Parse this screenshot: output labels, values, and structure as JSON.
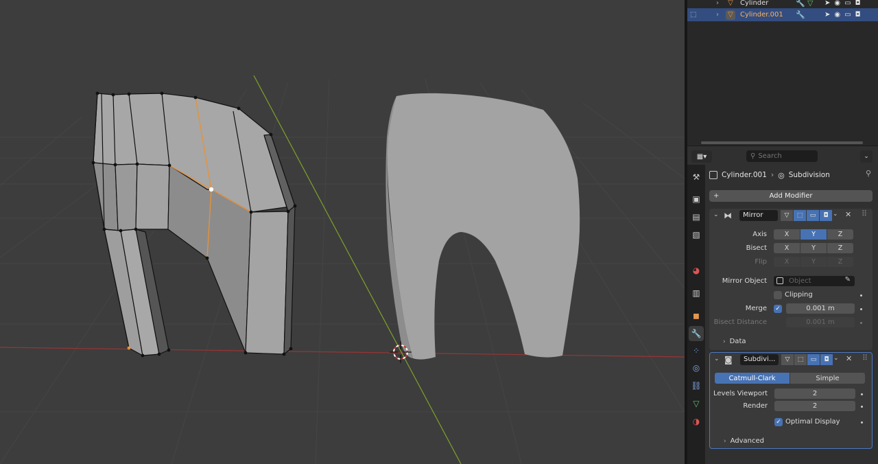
{
  "outliner": {
    "rows": [
      {
        "name": "Cylinder",
        "selected": false
      },
      {
        "name": "Cylinder.001",
        "selected": true
      }
    ]
  },
  "properties_header": {
    "search_placeholder": "Search"
  },
  "breadcrumb": {
    "object": "Cylinder.001",
    "modifier": "Subdivision"
  },
  "add_modifier_label": "Add Modifier",
  "mirror": {
    "name": "Mirror",
    "axis_label": "Axis",
    "bisect_label": "Bisect",
    "flip_label": "Flip",
    "axes": [
      "X",
      "Y",
      "Z"
    ],
    "axis_active": "Y",
    "mirror_object_label": "Mirror Object",
    "mirror_object_placeholder": "Object",
    "clipping_label": "Clipping",
    "clipping": false,
    "merge_label": "Merge",
    "merge": true,
    "merge_value": "0.001 m",
    "bisect_distance_label": "Bisect Distance",
    "bisect_distance_value": "0.001 m",
    "data_label": "Data"
  },
  "subdivision": {
    "name": "Subdivi...",
    "mode_options": [
      "Catmull-Clark",
      "Simple"
    ],
    "mode_active": "Catmull-Clark",
    "levels_viewport_label": "Levels Viewport",
    "levels_viewport": "2",
    "render_label": "Render",
    "render": "2",
    "optimal_display_label": "Optimal Display",
    "optimal_display": true,
    "advanced_label": "Advanced"
  },
  "colors": {
    "accent": "#4772b3",
    "selected_edge": "#e5923a",
    "x_axis": "#a83a3a",
    "y_axis": "#7ea32a"
  }
}
